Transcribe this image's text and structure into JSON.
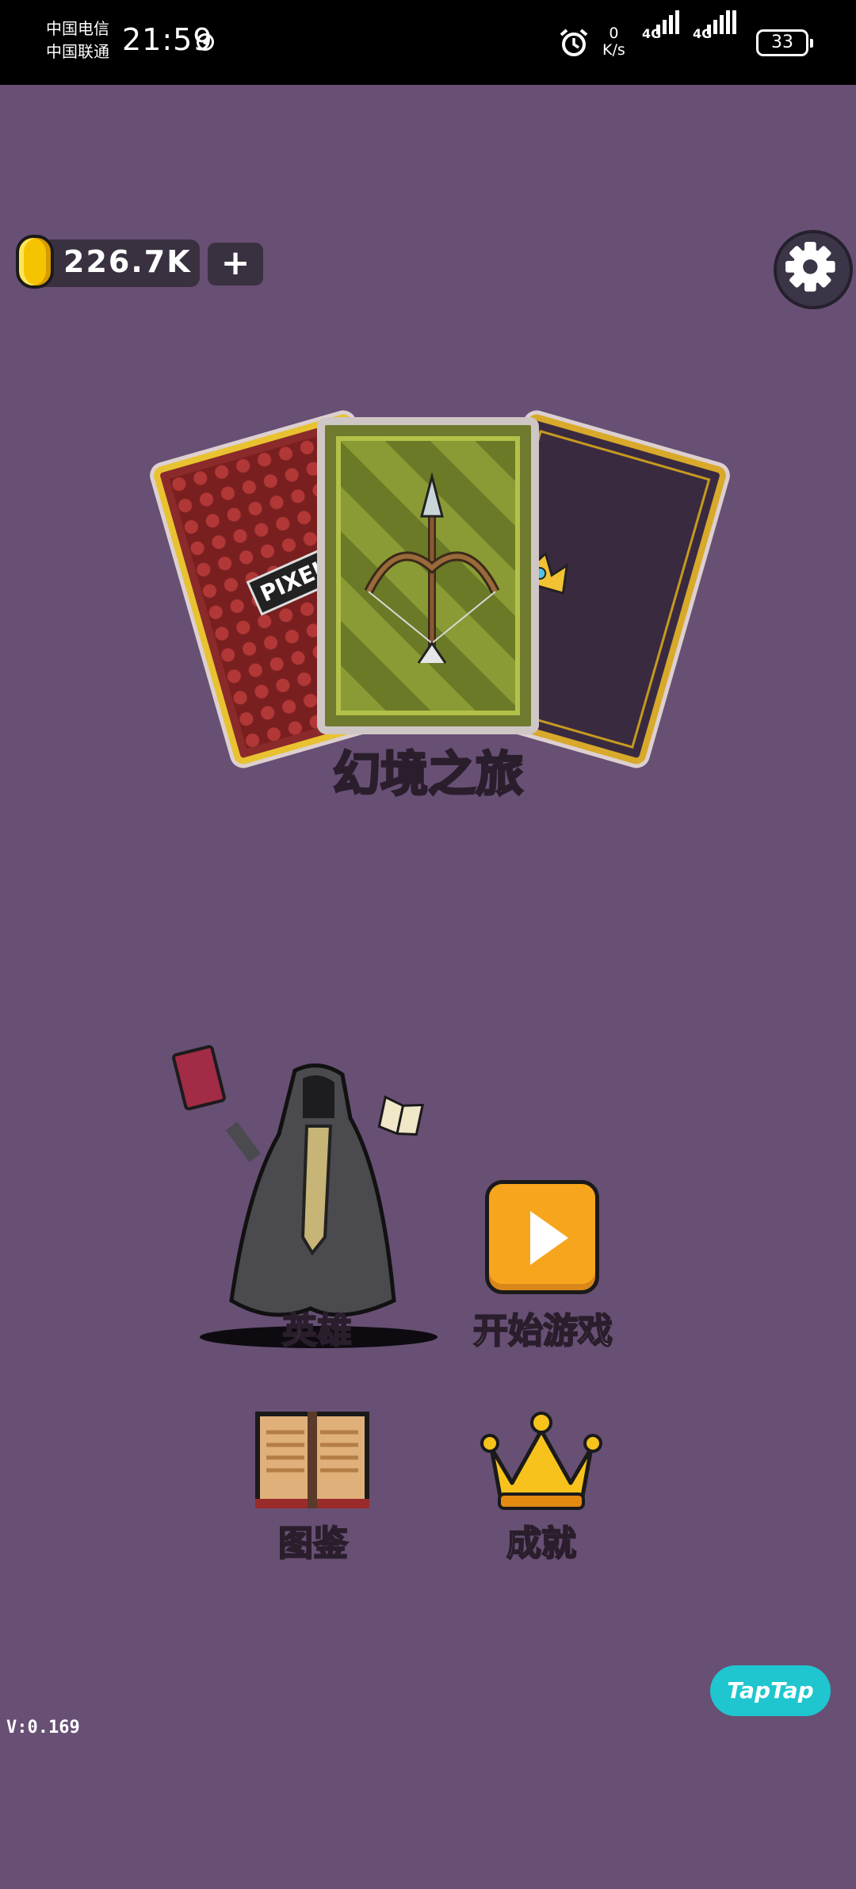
{
  "status_bar": {
    "carrier_1": "中国电信",
    "carrier_2": "中国联通",
    "time": "21:59",
    "net_speed_value": "0",
    "net_speed_unit": "K/s",
    "sim1_label": "4G",
    "sim2_label": "4G",
    "battery": "33"
  },
  "currency": {
    "coins": "226.7K",
    "add_label": "+"
  },
  "mode": {
    "title": "幻境之旅",
    "card_left_text": "PIXEL TR"
  },
  "menu": {
    "hero_label": "英雄",
    "start_label": "开始游戏",
    "codex_label": "图鉴",
    "achievement_label": "成就"
  },
  "badge": {
    "taptap": "TapTap"
  },
  "version": "V:0.169",
  "colors": {
    "background": "#684f74",
    "coin": "#f5c400",
    "play_button": "#f8a51e",
    "title_yellow": "#f3e12a",
    "taptap": "#1fc6cf"
  }
}
